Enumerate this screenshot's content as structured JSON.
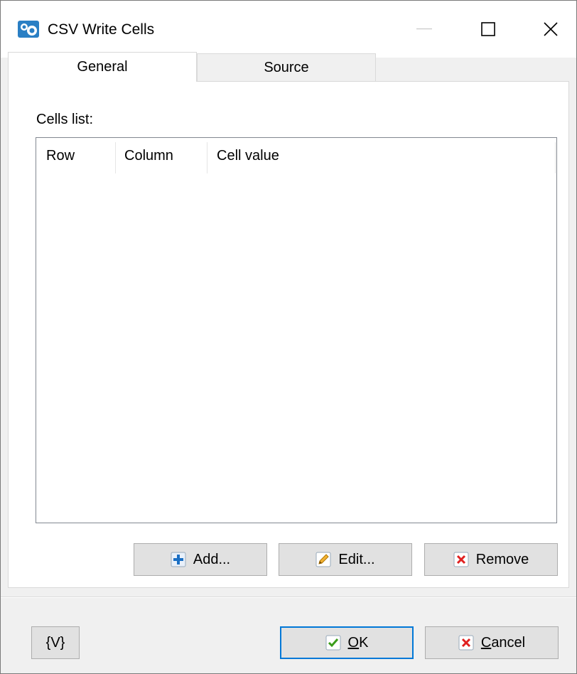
{
  "window": {
    "title": "CSV Write Cells"
  },
  "title_buttons": {
    "minimize": "—",
    "maximize": "☐",
    "close": "✕"
  },
  "tabs": [
    {
      "label": "General",
      "active": true
    },
    {
      "label": "Source",
      "active": false
    }
  ],
  "general": {
    "cells_label": "Cells list:",
    "columns": [
      "Row",
      "Column",
      "Cell value"
    ],
    "rows": []
  },
  "actions": {
    "add_label": "Add...",
    "edit_label": "Edit...",
    "remove_label": "Remove"
  },
  "footer": {
    "vars_label": "{V}",
    "ok_label": "OK",
    "cancel_label": "Cancel"
  },
  "colors": {
    "accent": "#0078d7",
    "plus_blue": "#1a6fc4",
    "remove_red": "#e02020",
    "check_green": "#3a9c1a",
    "edit_orange": "#d98a00"
  },
  "icons": [
    "app-icon",
    "plus-icon",
    "pencil-icon",
    "remove-x-icon",
    "check-icon",
    "cancel-x-icon"
  ]
}
